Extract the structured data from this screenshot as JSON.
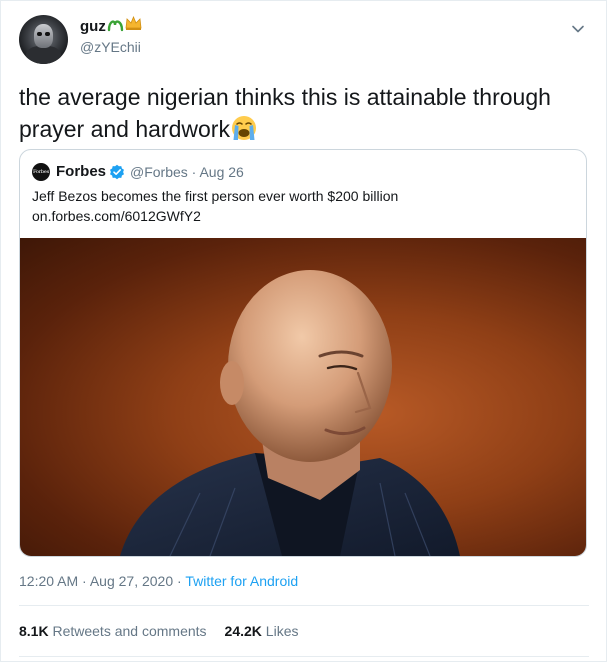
{
  "author": {
    "name": "guz",
    "handle": "@zYEchii"
  },
  "tweet": {
    "text": "the average nigerian thinks this is attainable through prayer and hardwork",
    "emoji": "loudly-crying-face"
  },
  "quoted_tweet": {
    "publisher_logo_text": "Forbes",
    "name": "Forbes",
    "verified": true,
    "handle_and_date": "@Forbes · Aug 26",
    "text": "Jeff Bezos becomes the first person ever worth $200 billion",
    "link": "on.forbes.com/6012GWfY2",
    "image": "portrait photo of a bald man in a dark jacket against an orange-brown background"
  },
  "meta": {
    "time_date": "12:20 AM · Aug 27, 2020 · ",
    "source": "Twitter for Android"
  },
  "stats": {
    "retweets_count": "8.1K",
    "retweets_label": " Retweets and comments",
    "likes_count": "24.2K",
    "likes_label": " Likes"
  },
  "colors": {
    "link_blue": "#1da1f2",
    "muted_gray": "#657786",
    "text_dark": "#14171a",
    "border": "#e6ecf0"
  },
  "icons": [
    "chevron-down-icon",
    "verified-badge-icon",
    "crying-emoji-icon",
    "bow-emoji-icon",
    "crown-emoji-icon"
  ]
}
